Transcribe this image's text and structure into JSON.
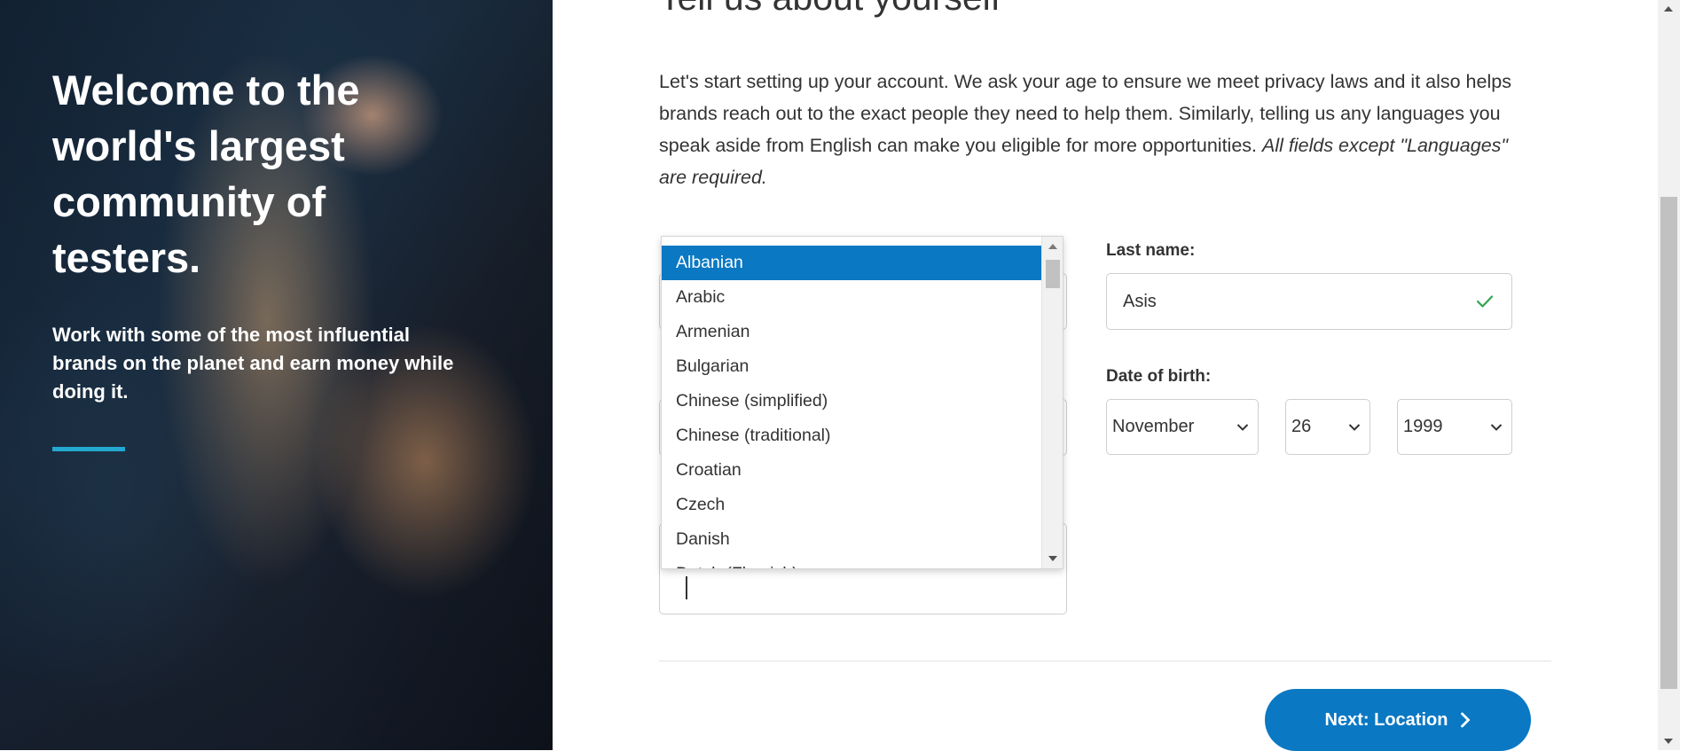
{
  "hero": {
    "title": "Welcome to the world's largest community of testers.",
    "subtitle": "Work with some of the most influential brands on the planet and earn money while doing it.",
    "accent_color": "#23a8cf"
  },
  "form": {
    "title": "Tell us about yourself",
    "intro": "Let's start setting up your account. We ask your age to ensure we meet privacy laws and it also helps brands reach out to the exact people they need to help them. Similarly, telling us any languages you speak aside from English can make you eligible for more opportunities.",
    "intro_note": "All fields except \"Languages\" are required.",
    "last_name": {
      "label": "Last name:",
      "value": "Asis"
    },
    "date_of_birth": {
      "label": "Date of birth:",
      "month": "November",
      "day": "26",
      "year": "1999"
    },
    "languages_dropdown": {
      "selected": "Albanian",
      "options": [
        "Albanian",
        "Arabic",
        "Armenian",
        "Bulgarian",
        "Chinese (simplified)",
        "Chinese (traditional)",
        "Croatian",
        "Czech",
        "Danish",
        "Dutch (Flemish)"
      ]
    },
    "next_button": "Next: Location"
  },
  "colors": {
    "primary": "#0a78c3",
    "success_check": "#2ea44f",
    "accent": "#23a8cf"
  },
  "icons": [
    "check-icon",
    "chevron-down-icon",
    "chevron-right-icon"
  ]
}
